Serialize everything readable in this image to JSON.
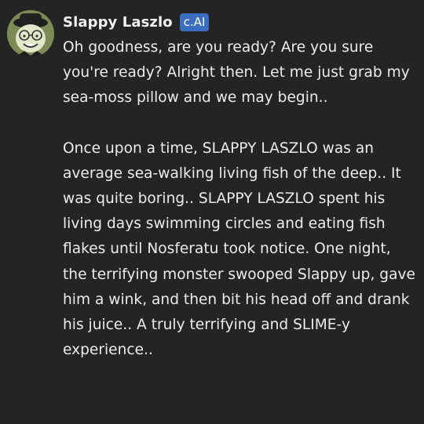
{
  "message": {
    "author": "Slappy Laszlo",
    "badge": "c.AI",
    "avatar_icon": "character-avatar",
    "paragraphs": [
      "Oh goodness, are you ready? Are you sure you're ready? Alright then. Let me just grab my sea-moss pillow and we may begin..",
      "Once upon a time, SLAPPY LASZLO was an average sea-walking living fish of the deep.. It was quite boring.. SLAPPY LASZLO spent his living days swimming circles and eating fish flakes until Nosferatu took notice. One night,  the terrifying monster swooped Slappy up, gave him a wink, and then bit his head off and drank his juice.. A truly terrifying and SLIME-y experience.."
    ]
  },
  "colors": {
    "background": "#242424",
    "text": "#ececec",
    "badge": "#3a6ec2"
  }
}
